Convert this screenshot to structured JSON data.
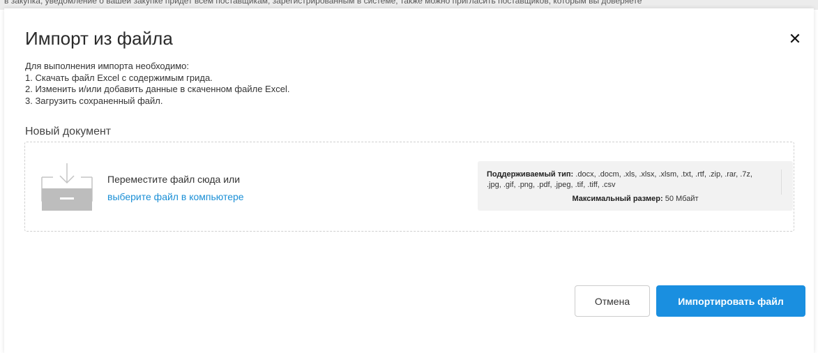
{
  "background": {
    "truncated_text": "в закупка, уведомление о вашей закупке придет всем поставщикам, зарегистрированным в системе, также можно пригласить поставщиков, которым вы доверяете"
  },
  "modal": {
    "title": "Импорт из файла",
    "close_icon": "close-icon",
    "instructions": {
      "intro": "Для выполнения импорта необходимо:",
      "step1": "1. Скачать файл Excel с содержимым грида.",
      "step2": "2. Изменить и/или добавить данные в скаченном файле Excel.",
      "step3": "3. Загрузить сохраненный файл."
    },
    "section_label": "Новый документ",
    "dropzone": {
      "icon": "upload-tray-icon",
      "text": "Переместите файл сюда или",
      "link": "выберите файл в компьютере",
      "types_label": "Поддерживаемый тип:",
      "types_value": " .docx, .docm, .xls, .xlsx, .xlsm, .txt, .rtf, .zip, .rar, .7z, .jpg, .gif, .png, .pdf, .jpeg, .tif, .tiff, .csv",
      "size_label": "Максимальный размер:",
      "size_value": " 50 Мбайт"
    },
    "buttons": {
      "cancel": "Отмена",
      "import": "Импортировать файл"
    }
  },
  "colors": {
    "accent": "#1a8fe0",
    "link": "#1a8fd6"
  }
}
